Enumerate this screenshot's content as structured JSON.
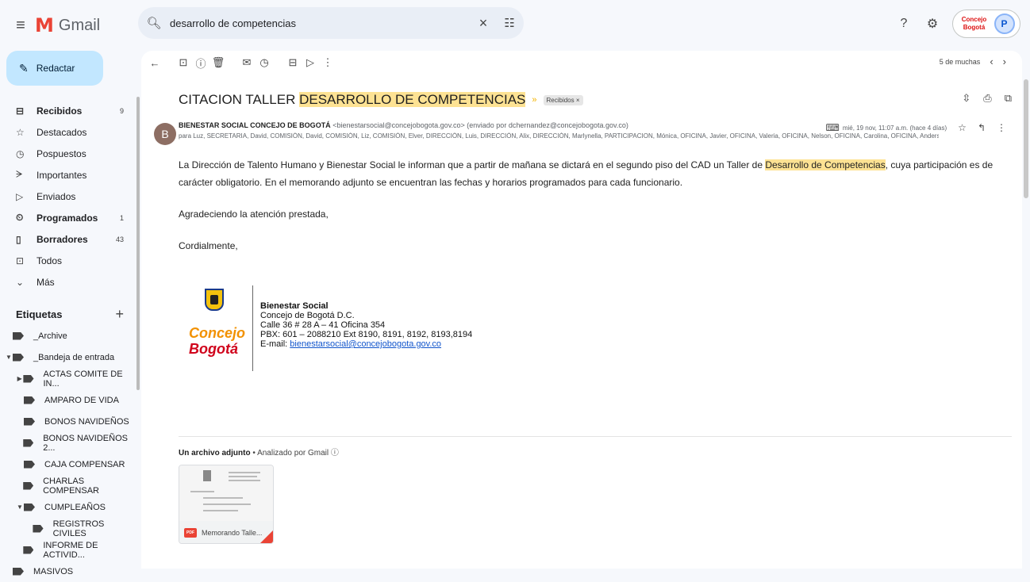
{
  "app": {
    "name": "Gmail"
  },
  "search": {
    "query": "desarrollo de competencias"
  },
  "account": {
    "logo_text": "Concejo Bogotá",
    "avatar_initial": "P"
  },
  "compose": {
    "label": "Redactar"
  },
  "nav": [
    {
      "label": "Recibidos",
      "count": "9",
      "bold": true,
      "icon": "inbox-icon"
    },
    {
      "label": "Destacados",
      "count": "",
      "bold": false,
      "icon": "star-icon"
    },
    {
      "label": "Pospuestos",
      "count": "",
      "bold": false,
      "icon": "clock-icon"
    },
    {
      "label": "Importantes",
      "count": "",
      "bold": false,
      "icon": "important-icon"
    },
    {
      "label": "Enviados",
      "count": "",
      "bold": false,
      "icon": "send-icon"
    },
    {
      "label": "Programados",
      "count": "1",
      "bold": true,
      "icon": "scheduled-icon"
    },
    {
      "label": "Borradores",
      "count": "43",
      "bold": true,
      "icon": "draft-icon"
    },
    {
      "label": "Todos",
      "count": "",
      "bold": false,
      "icon": "all-mail-icon"
    },
    {
      "label": "Más",
      "count": "",
      "bold": false,
      "icon": "chevron-down-icon"
    }
  ],
  "labels": {
    "heading": "Etiquetas",
    "items": [
      {
        "label": "_Archive",
        "caret": ""
      },
      {
        "label": "_Bandeja de entrada",
        "caret": "▼"
      },
      {
        "label": "ACTAS COMITE DE IN...",
        "caret": "▶"
      },
      {
        "label": "AMPARO DE VIDA",
        "caret": ""
      },
      {
        "label": "BONOS NAVIDEÑOS",
        "caret": ""
      },
      {
        "label": "BONOS NAVIDEÑOS 2...",
        "caret": ""
      },
      {
        "label": "CAJA COMPENSAR",
        "caret": ""
      },
      {
        "label": "CHARLAS COMPENSAR",
        "caret": ""
      },
      {
        "label": "CUMPLEAÑOS",
        "caret": "▼"
      },
      {
        "label": "REGISTROS CIVILES",
        "caret": ""
      },
      {
        "label": "INFORME DE ACTIVID...",
        "caret": ""
      },
      {
        "label": "MASIVOS",
        "caret": ""
      }
    ]
  },
  "pager": {
    "text": "5 de muchas"
  },
  "email": {
    "subject_prefix": "CITACION TALLER ",
    "subject_highlight": "DESARROLLO DE COMPETENCIAS",
    "inbox_chip": "Recibidos ×",
    "sender_initial": "B",
    "sender_name": "BIENESTAR SOCIAL CONCEJO DE BOGOTÁ",
    "sender_email": "<bienestarsocial@concejobogota.gov.co> (enviado por dchernandez@concejobogota.gov.co)",
    "date": "mié, 19 nov, 11:07 a.m. (hace 4 días)",
    "to": "para Luz, SECRETARIA, David, COMISIÓN, David, COMISIÓN, Liz, COMISIÓN, Elver, DIRECCIÓN, Luis, DIRECCIÓN, Alix, DIRECCIÓN, Marlynella, PARTICIPACION, Mónica, OFICINA, Javier, OFICINA, Valeria, OFICINA, Nelson, OFICINA, Carolina, OFICINA, Anderson, BLAN",
    "body_p1_a": "La Dirección de Talento Humano y Bienestar Social le informan que a partir de mañana se dictará en el segundo piso del CAD un Taller de ",
    "body_p1_hl": "Desarrollo de Competencias",
    "body_p1_b": ", cuya participación es de carácter obligatorio. En el memorando adjunto se encuentran las fechas y horarios programados para cada funcionario.",
    "body_p2": "Agradeciendo la atención prestada,",
    "body_p3": "Cordialmente,",
    "sig_logo_a": "Concejo",
    "sig_logo_b": "Bogotá",
    "sig_name": "Bienestar Social",
    "sig_org": "Concejo de Bogotá D.C.",
    "sig_addr": "Calle 36 # 28  A – 41 Oficina 354",
    "sig_pbx": "PBX: 601 – 2088210 Ext 8190, 8191, 8192, 8193,8194",
    "sig_email_label": "E-mail: ",
    "sig_email": "bienestarsocial@concejobogota.gov.co",
    "attach_title": "Un archivo adjunto",
    "attach_scan": " • Analizado por Gmail ⓘ",
    "attach_name": "Memorando Talle...",
    "attach_badge": "PDF"
  }
}
